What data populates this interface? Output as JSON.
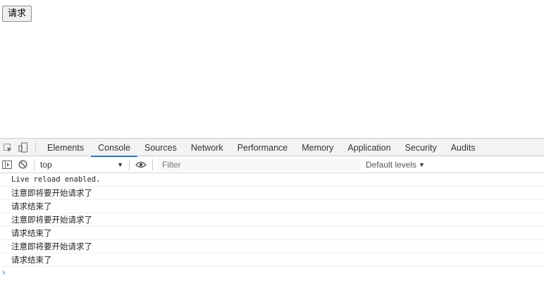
{
  "page": {
    "request_button_label": "请求"
  },
  "devtools": {
    "tabs": [
      {
        "label": "Elements",
        "active": false
      },
      {
        "label": "Console",
        "active": true
      },
      {
        "label": "Sources",
        "active": false
      },
      {
        "label": "Network",
        "active": false
      },
      {
        "label": "Performance",
        "active": false
      },
      {
        "label": "Memory",
        "active": false
      },
      {
        "label": "Application",
        "active": false
      },
      {
        "label": "Security",
        "active": false
      },
      {
        "label": "Audits",
        "active": false
      }
    ],
    "toolbar": {
      "context": "top",
      "filter_placeholder": "Filter",
      "levels_label": "Default levels"
    },
    "messages": [
      "Live reload enabled.",
      "注意即将要开始请求了",
      "请求结束了",
      "注意即将要开始请求了",
      "请求结束了",
      "注意即将要开始请求了",
      "请求结束了"
    ],
    "accent_color": "#1a73e8"
  }
}
